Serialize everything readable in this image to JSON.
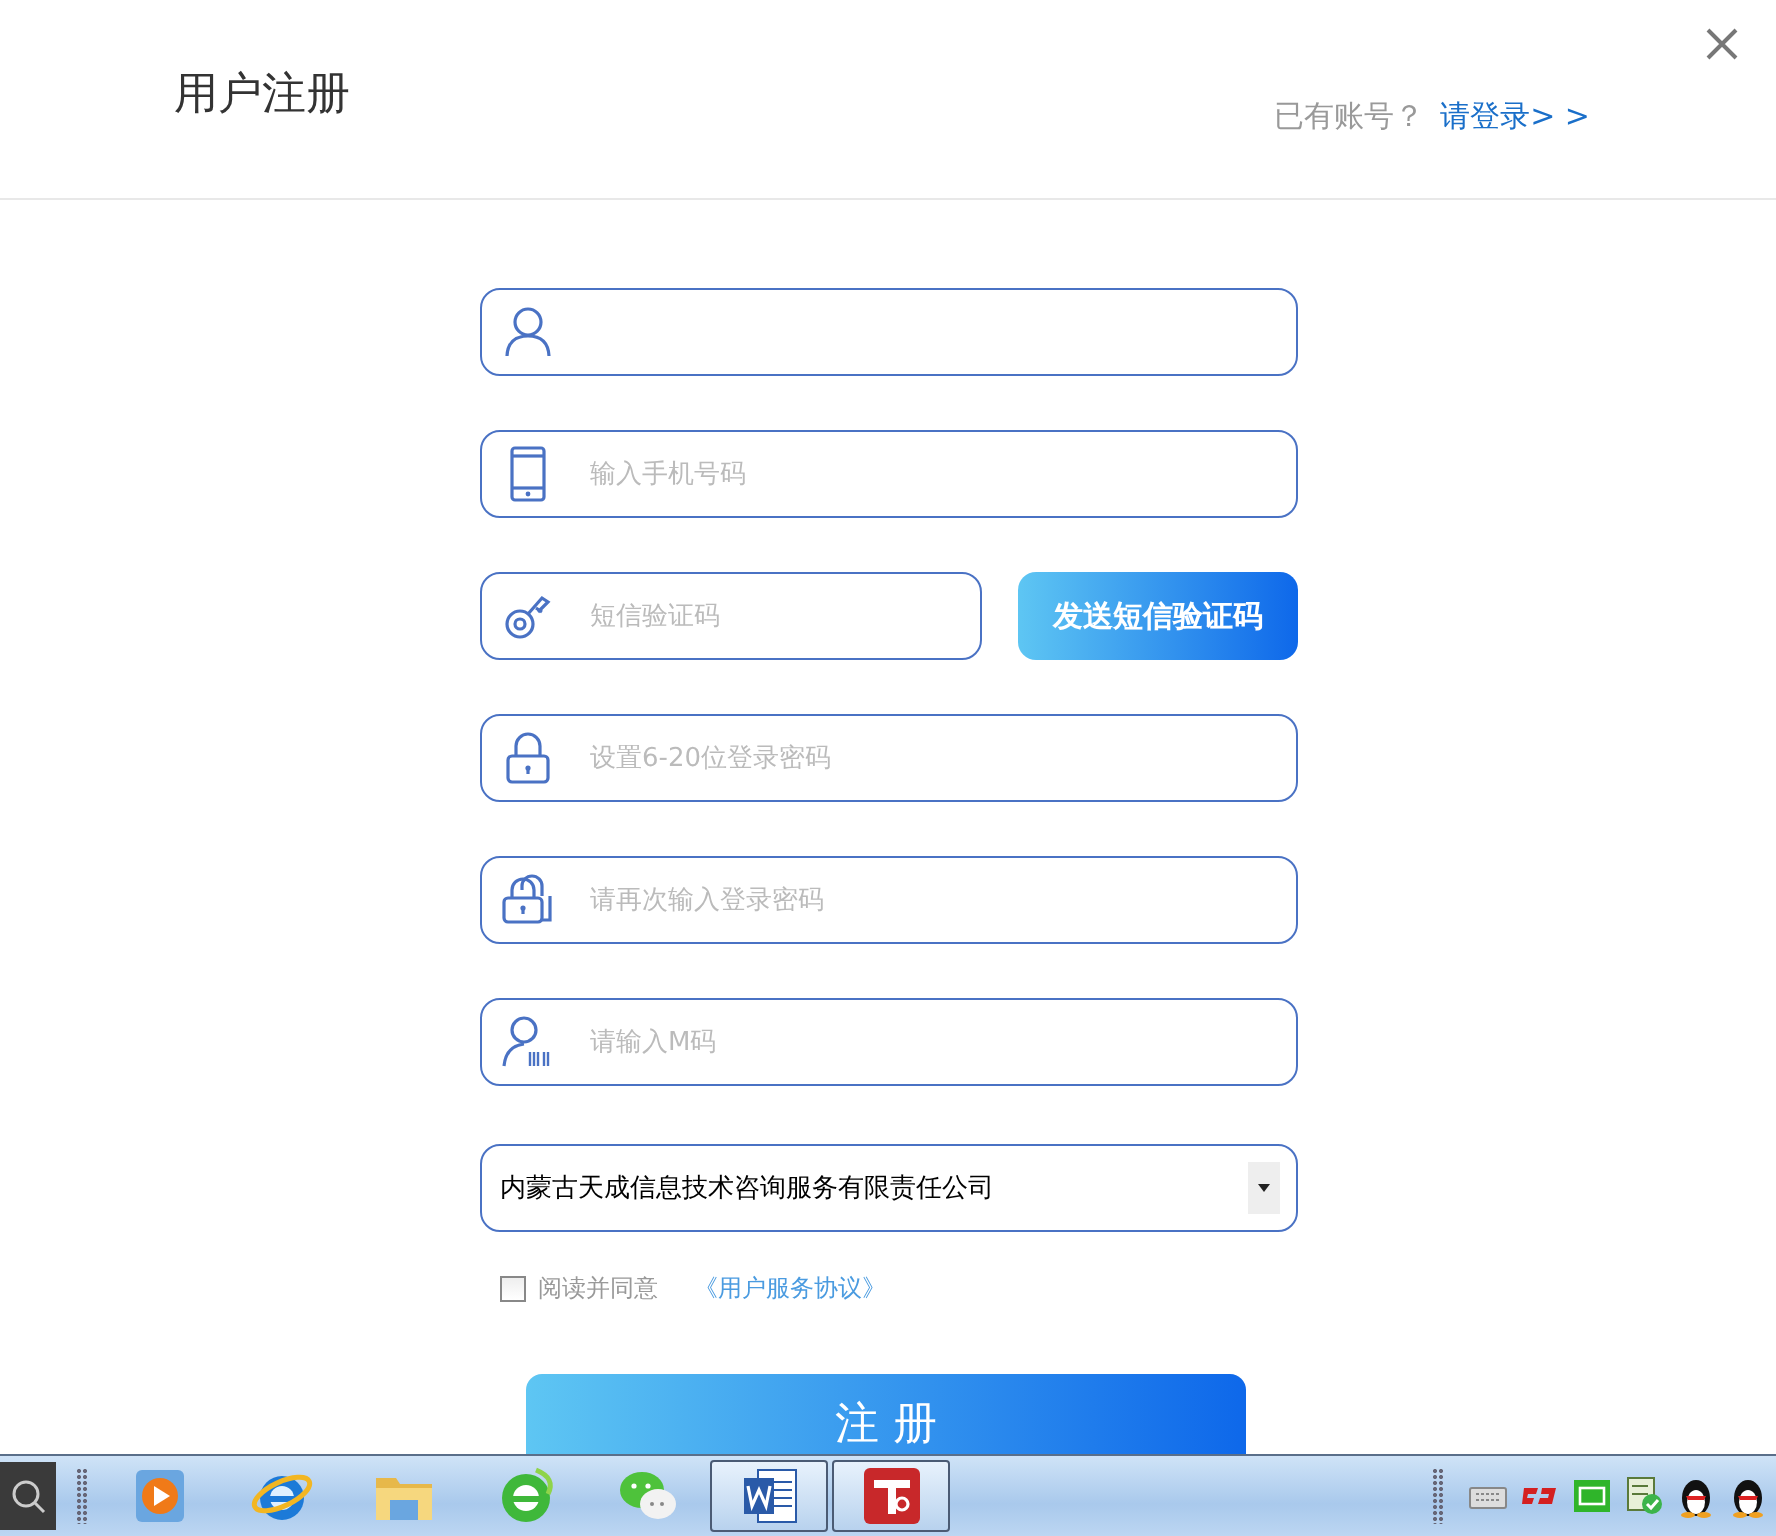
{
  "window": {
    "title": "用户注册"
  },
  "login_prompt": {
    "text": "已有账号？",
    "link": "请登录> >"
  },
  "fields": [
    {
      "kind": "user"
    },
    {
      "kind": "phone",
      "placeholder": "输入手机号码"
    },
    {
      "kind": "key",
      "placeholder": "短信验证码",
      "button": "发送短信验证码"
    },
    {
      "kind": "lock",
      "placeholder": "设置6-20位登录密码"
    },
    {
      "kind": "locks",
      "placeholder": "请再次输入登录密码"
    },
    {
      "kind": "badge",
      "placeholder": "请输入M码"
    }
  ],
  "company_select": {
    "value": "内蒙古天成信息技术咨询服务有限责任公司"
  },
  "agreement": {
    "checked": false,
    "text": "阅读并同意",
    "link": "《用户服务协议》"
  },
  "submit": "注 册",
  "taskbar": {
    "apps": [
      {
        "kind": "player",
        "selected": false
      },
      {
        "kind": "browser",
        "selected": false
      },
      {
        "kind": "folder",
        "selected": false
      },
      {
        "kind": "browser2",
        "selected": false
      },
      {
        "kind": "chat",
        "selected": false
      },
      {
        "kind": "word",
        "selected": true
      },
      {
        "kind": "tool",
        "selected": true
      }
    ]
  }
}
